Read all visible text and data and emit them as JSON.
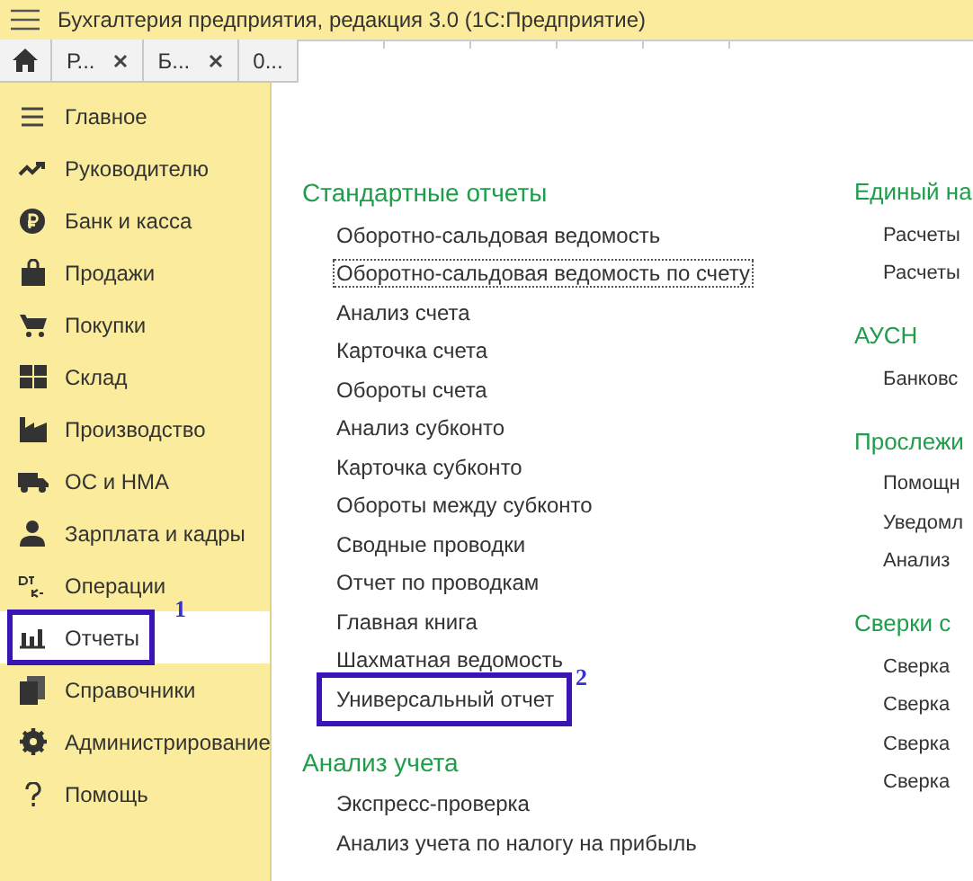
{
  "window": {
    "title": "Бухгалтерия предприятия, редакция 3.0  (1С:Предприятие)"
  },
  "tabs": [
    {
      "label": "Р...",
      "closable": true
    },
    {
      "label": "Б...",
      "closable": true
    },
    {
      "label": "0...",
      "closable": false
    }
  ],
  "sidebar": {
    "items": [
      {
        "label": "Главное",
        "selected": false
      },
      {
        "label": "Руководителю",
        "selected": false
      },
      {
        "label": "Банк и касса",
        "selected": false
      },
      {
        "label": "Продажи",
        "selected": false
      },
      {
        "label": "Покупки",
        "selected": false
      },
      {
        "label": "Склад",
        "selected": false
      },
      {
        "label": "Производство",
        "selected": false
      },
      {
        "label": "ОС и НМА",
        "selected": false
      },
      {
        "label": "Зарплата и кадры",
        "selected": false
      },
      {
        "label": "Операции",
        "selected": false
      },
      {
        "label": "Отчеты",
        "selected": true,
        "callout": "1"
      },
      {
        "label": "Справочники",
        "selected": false
      },
      {
        "label": "Администрирование",
        "selected": false
      },
      {
        "label": "Помощь",
        "selected": false
      }
    ]
  },
  "sections": [
    {
      "title": "Стандартные отчеты",
      "links": [
        {
          "label": "Оборотно-сальдовая ведомость",
          "focused": false
        },
        {
          "label": "Оборотно-сальдовая ведомость по счету",
          "focused": true
        },
        {
          "label": "Анализ счета",
          "focused": false
        },
        {
          "label": "Карточка счета",
          "focused": false
        },
        {
          "label": "Обороты счета",
          "focused": false
        },
        {
          "label": "Анализ субконто",
          "focused": false
        },
        {
          "label": "Карточка субконто",
          "focused": false
        },
        {
          "label": "Обороты между субконто",
          "focused": false
        },
        {
          "label": "Сводные проводки",
          "focused": false
        },
        {
          "label": "Отчет по проводкам",
          "focused": false
        },
        {
          "label": "Главная книга",
          "focused": false
        },
        {
          "label": "Шахматная ведомость",
          "focused": false
        },
        {
          "label": "Универсальный отчет",
          "focused": false,
          "callout": "2"
        }
      ]
    },
    {
      "title": "Анализ учета",
      "links": [
        {
          "label": "Экспресс-проверка",
          "focused": false
        },
        {
          "label": "Анализ учета по налогу на прибыль",
          "focused": false
        }
      ]
    }
  ],
  "sections_right": [
    {
      "title": "Единый на",
      "links": [
        {
          "label": "Расчеты"
        },
        {
          "label": "Расчеты"
        }
      ]
    },
    {
      "title": "АУСН",
      "links": [
        {
          "label": "Банковс"
        }
      ]
    },
    {
      "title": "Прослежи",
      "links": [
        {
          "label": "Помощн"
        },
        {
          "label": "Уведомл"
        },
        {
          "label": "Анализ"
        }
      ]
    },
    {
      "title": "Сверки с",
      "links": [
        {
          "label": "Сверка"
        },
        {
          "label": "Сверка"
        },
        {
          "label": "Сверка"
        },
        {
          "label": "Сверка"
        }
      ]
    }
  ]
}
